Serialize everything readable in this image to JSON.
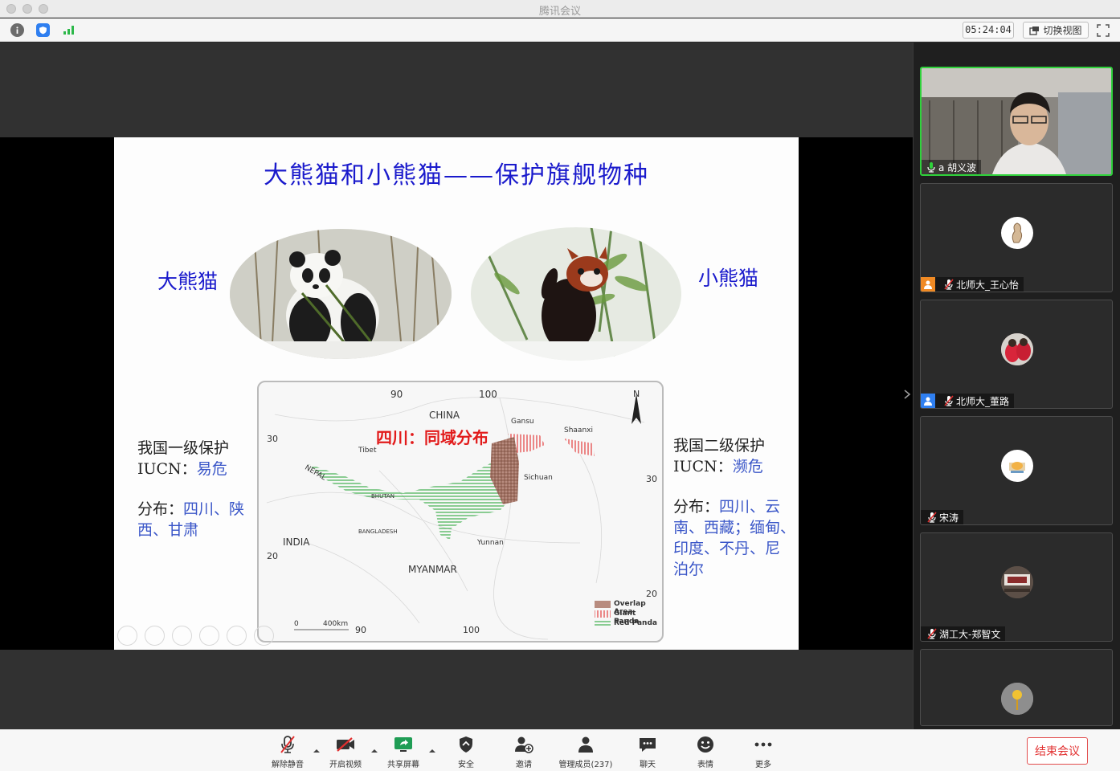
{
  "window": {
    "title": "腾讯会议"
  },
  "topbar": {
    "icons": [
      "info-icon",
      "shield-icon",
      "signal-icon"
    ],
    "timer": "05:24:04",
    "switch_view_label": "切换视图"
  },
  "slide": {
    "title": "大熊猫和小熊猫——保护旗舰物种",
    "giant_panda_label": "大熊猫",
    "red_panda_label": "小熊猫",
    "left_info": {
      "protection": "我国一级保护",
      "iucn_prefix": "IUCN：",
      "iucn_status": "易危",
      "dist_prefix": "分布：",
      "dist_line1": "四川、陕",
      "dist_line2": "西、甘肃"
    },
    "right_info": {
      "protection": "我国二级保护",
      "iucn_prefix": "IUCN：",
      "iucn_status": "濒危",
      "dist_prefix": "分布：",
      "dist_line1": "四川、云",
      "dist_line2": "南、西藏；缅甸、",
      "dist_line3": "印度、不丹、尼",
      "dist_line4": "泊尔"
    },
    "map": {
      "highlight": "四川：同域分布",
      "ticks": {
        "top_90": "90",
        "top_100": "100",
        "left_30": "30",
        "left_20": "20",
        "right_30": "30",
        "right_20": "20",
        "bottom_90": "90",
        "bottom_100": "100"
      },
      "places": {
        "china": "CHINA",
        "gansu": "Gansu",
        "shaanxi": "Shaanxi",
        "tibet": "Tibet",
        "nepal": "NEPAL",
        "bhutan": "BHUTAN",
        "sichuan": "Sichuan",
        "bangladesh": "BANGLADESH",
        "india": "INDIA",
        "yunnan": "Yunnan",
        "myanmar": "MYANMAR"
      },
      "north": "N",
      "scale_zero": "0",
      "scale_label": "400km",
      "legend": [
        "Overlap Area",
        "Giant Panda",
        "Red Panda"
      ]
    }
  },
  "participants": [
    {
      "name": "a 胡义波",
      "active": true
    },
    {
      "name": "北师大_王心怡",
      "badge": "orange"
    },
    {
      "name": "北师大_董路",
      "badge": "blue"
    },
    {
      "name": "宋涛"
    },
    {
      "name": "湖工大-郑智文"
    },
    {
      "name": ""
    }
  ],
  "toolbar": {
    "unmute": "解除静音",
    "start_video": "开启视频",
    "share_screen": "共享屏幕",
    "security": "安全",
    "invite": "邀请",
    "manage_members": "管理成员(237)",
    "chat": "聊天",
    "reactions": "表情",
    "more": "更多",
    "end_meeting": "结束会议"
  },
  "colors": {
    "slide_title": "#1a1acc",
    "highlight_red": "#e21b1b",
    "active_speaker": "#2fd23b",
    "end_button": "#e23030"
  }
}
